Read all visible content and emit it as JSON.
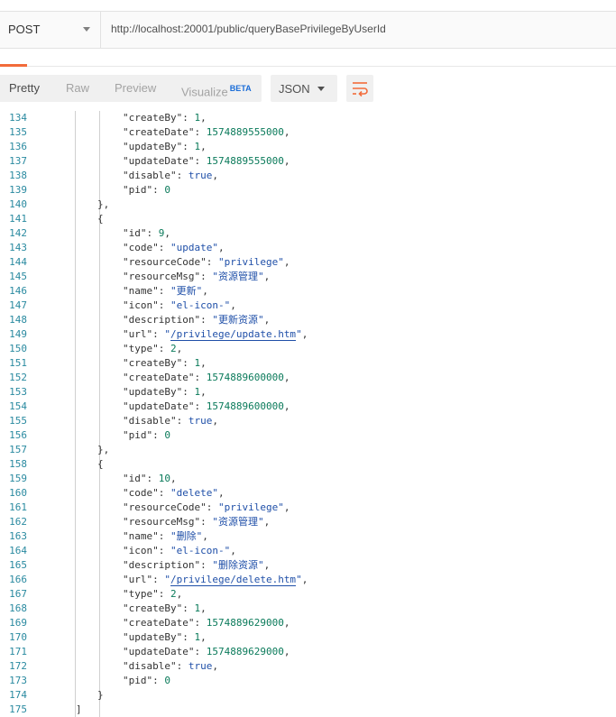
{
  "request": {
    "method": "POST",
    "url": "http://localhost:20001/public/queryBasePrivilegeByUserId"
  },
  "response_toolbar": {
    "tabs": [
      "Pretty",
      "Raw",
      "Preview",
      "Visualize"
    ],
    "beta_badge": "BETA",
    "active_tab": "Pretty",
    "format": "JSON"
  },
  "colors": {
    "accent": "#f26b3a",
    "line_number": "#2a8aa0",
    "string": "#1f4fa8",
    "number": "#0a7a5a"
  },
  "code_lines": [
    {
      "n": 134,
      "indent": 2,
      "t": [
        [
          "k",
          "\"createBy\": "
        ],
        [
          "n",
          "1"
        ],
        [
          "k",
          ","
        ]
      ]
    },
    {
      "n": 135,
      "indent": 2,
      "t": [
        [
          "k",
          "\"createDate\": "
        ],
        [
          "n",
          "1574889555000"
        ],
        [
          "k",
          ","
        ]
      ]
    },
    {
      "n": 136,
      "indent": 2,
      "t": [
        [
          "k",
          "\"updateBy\": "
        ],
        [
          "n",
          "1"
        ],
        [
          "k",
          ","
        ]
      ]
    },
    {
      "n": 137,
      "indent": 2,
      "t": [
        [
          "k",
          "\"updateDate\": "
        ],
        [
          "n",
          "1574889555000"
        ],
        [
          "k",
          ","
        ]
      ]
    },
    {
      "n": 138,
      "indent": 2,
      "t": [
        [
          "k",
          "\"disable\": "
        ],
        [
          "b",
          "true"
        ],
        [
          "k",
          ","
        ]
      ]
    },
    {
      "n": 139,
      "indent": 2,
      "t": [
        [
          "k",
          "\"pid\": "
        ],
        [
          "n",
          "0"
        ]
      ]
    },
    {
      "n": 140,
      "indent": 1,
      "t": [
        [
          "k",
          "},"
        ]
      ]
    },
    {
      "n": 141,
      "indent": 1,
      "t": [
        [
          "k",
          "{"
        ]
      ]
    },
    {
      "n": 142,
      "indent": 2,
      "t": [
        [
          "k",
          "\"id\": "
        ],
        [
          "n",
          "9"
        ],
        [
          "k",
          ","
        ]
      ]
    },
    {
      "n": 143,
      "indent": 2,
      "t": [
        [
          "k",
          "\"code\": "
        ],
        [
          "s",
          "\"update\""
        ],
        [
          "k",
          ","
        ]
      ]
    },
    {
      "n": 144,
      "indent": 2,
      "t": [
        [
          "k",
          "\"resourceCode\": "
        ],
        [
          "s",
          "\"privilege\""
        ],
        [
          "k",
          ","
        ]
      ]
    },
    {
      "n": 145,
      "indent": 2,
      "t": [
        [
          "k",
          "\"resourceMsg\": "
        ],
        [
          "s",
          "\"资源管理\""
        ],
        [
          "k",
          ","
        ]
      ]
    },
    {
      "n": 146,
      "indent": 2,
      "t": [
        [
          "k",
          "\"name\": "
        ],
        [
          "s",
          "\"更新\""
        ],
        [
          "k",
          ","
        ]
      ]
    },
    {
      "n": 147,
      "indent": 2,
      "t": [
        [
          "k",
          "\"icon\": "
        ],
        [
          "s",
          "\"el-icon-\""
        ],
        [
          "k",
          ","
        ]
      ]
    },
    {
      "n": 148,
      "indent": 2,
      "t": [
        [
          "k",
          "\"description\": "
        ],
        [
          "s",
          "\"更新资源\""
        ],
        [
          "k",
          ","
        ]
      ]
    },
    {
      "n": 149,
      "indent": 2,
      "t": [
        [
          "k",
          "\"url\": "
        ],
        [
          "s",
          "\""
        ],
        [
          "u",
          "/privilege/update.htm"
        ],
        [
          "s",
          "\""
        ],
        [
          "k",
          ","
        ]
      ]
    },
    {
      "n": 150,
      "indent": 2,
      "t": [
        [
          "k",
          "\"type\": "
        ],
        [
          "n",
          "2"
        ],
        [
          "k",
          ","
        ]
      ]
    },
    {
      "n": 151,
      "indent": 2,
      "t": [
        [
          "k",
          "\"createBy\": "
        ],
        [
          "n",
          "1"
        ],
        [
          "k",
          ","
        ]
      ]
    },
    {
      "n": 152,
      "indent": 2,
      "t": [
        [
          "k",
          "\"createDate\": "
        ],
        [
          "n",
          "1574889600000"
        ],
        [
          "k",
          ","
        ]
      ]
    },
    {
      "n": 153,
      "indent": 2,
      "t": [
        [
          "k",
          "\"updateBy\": "
        ],
        [
          "n",
          "1"
        ],
        [
          "k",
          ","
        ]
      ]
    },
    {
      "n": 154,
      "indent": 2,
      "t": [
        [
          "k",
          "\"updateDate\": "
        ],
        [
          "n",
          "1574889600000"
        ],
        [
          "k",
          ","
        ]
      ]
    },
    {
      "n": 155,
      "indent": 2,
      "t": [
        [
          "k",
          "\"disable\": "
        ],
        [
          "b",
          "true"
        ],
        [
          "k",
          ","
        ]
      ]
    },
    {
      "n": 156,
      "indent": 2,
      "t": [
        [
          "k",
          "\"pid\": "
        ],
        [
          "n",
          "0"
        ]
      ]
    },
    {
      "n": 157,
      "indent": 1,
      "t": [
        [
          "k",
          "},"
        ]
      ]
    },
    {
      "n": 158,
      "indent": 1,
      "t": [
        [
          "k",
          "{"
        ]
      ]
    },
    {
      "n": 159,
      "indent": 2,
      "t": [
        [
          "k",
          "\"id\": "
        ],
        [
          "n",
          "10"
        ],
        [
          "k",
          ","
        ]
      ]
    },
    {
      "n": 160,
      "indent": 2,
      "t": [
        [
          "k",
          "\"code\": "
        ],
        [
          "s",
          "\"delete\""
        ],
        [
          "k",
          ","
        ]
      ]
    },
    {
      "n": 161,
      "indent": 2,
      "t": [
        [
          "k",
          "\"resourceCode\": "
        ],
        [
          "s",
          "\"privilege\""
        ],
        [
          "k",
          ","
        ]
      ]
    },
    {
      "n": 162,
      "indent": 2,
      "t": [
        [
          "k",
          "\"resourceMsg\": "
        ],
        [
          "s",
          "\"资源管理\""
        ],
        [
          "k",
          ","
        ]
      ]
    },
    {
      "n": 163,
      "indent": 2,
      "t": [
        [
          "k",
          "\"name\": "
        ],
        [
          "s",
          "\"删除\""
        ],
        [
          "k",
          ","
        ]
      ]
    },
    {
      "n": 164,
      "indent": 2,
      "t": [
        [
          "k",
          "\"icon\": "
        ],
        [
          "s",
          "\"el-icon-\""
        ],
        [
          "k",
          ","
        ]
      ]
    },
    {
      "n": 165,
      "indent": 2,
      "t": [
        [
          "k",
          "\"description\": "
        ],
        [
          "s",
          "\"删除资源\""
        ],
        [
          "k",
          ","
        ]
      ]
    },
    {
      "n": 166,
      "indent": 2,
      "t": [
        [
          "k",
          "\"url\": "
        ],
        [
          "s",
          "\""
        ],
        [
          "u",
          "/privilege/delete.htm"
        ],
        [
          "s",
          "\""
        ],
        [
          "k",
          ","
        ]
      ]
    },
    {
      "n": 167,
      "indent": 2,
      "t": [
        [
          "k",
          "\"type\": "
        ],
        [
          "n",
          "2"
        ],
        [
          "k",
          ","
        ]
      ]
    },
    {
      "n": 168,
      "indent": 2,
      "t": [
        [
          "k",
          "\"createBy\": "
        ],
        [
          "n",
          "1"
        ],
        [
          "k",
          ","
        ]
      ]
    },
    {
      "n": 169,
      "indent": 2,
      "t": [
        [
          "k",
          "\"createDate\": "
        ],
        [
          "n",
          "1574889629000"
        ],
        [
          "k",
          ","
        ]
      ]
    },
    {
      "n": 170,
      "indent": 2,
      "t": [
        [
          "k",
          "\"updateBy\": "
        ],
        [
          "n",
          "1"
        ],
        [
          "k",
          ","
        ]
      ]
    },
    {
      "n": 171,
      "indent": 2,
      "t": [
        [
          "k",
          "\"updateDate\": "
        ],
        [
          "n",
          "1574889629000"
        ],
        [
          "k",
          ","
        ]
      ]
    },
    {
      "n": 172,
      "indent": 2,
      "t": [
        [
          "k",
          "\"disable\": "
        ],
        [
          "b",
          "true"
        ],
        [
          "k",
          ","
        ]
      ]
    },
    {
      "n": 173,
      "indent": 2,
      "t": [
        [
          "k",
          "\"pid\": "
        ],
        [
          "n",
          "0"
        ]
      ]
    },
    {
      "n": 174,
      "indent": 1,
      "t": [
        [
          "k",
          "}"
        ]
      ]
    },
    {
      "n": 175,
      "indent": 0,
      "t": [
        [
          "k",
          "]"
        ]
      ]
    }
  ]
}
